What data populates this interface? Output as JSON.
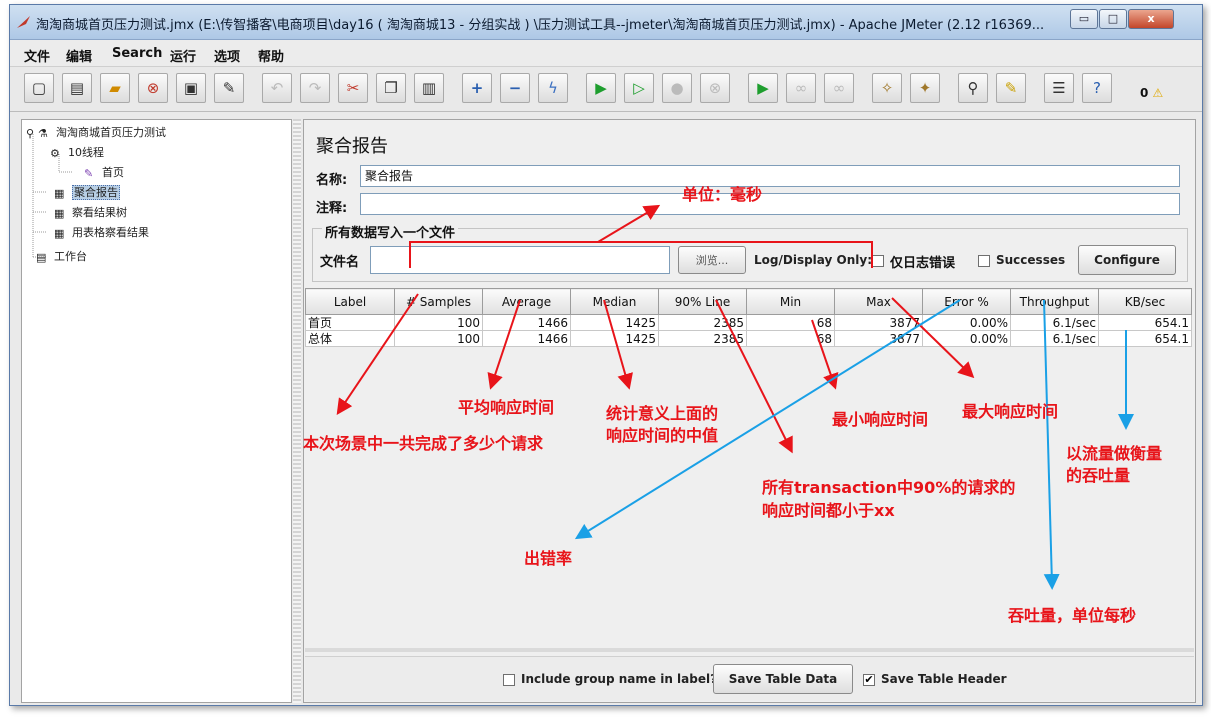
{
  "window": {
    "title": "淘淘商城首页压力测试.jmx (E:\\传智播客\\电商项目\\day16 ( 淘淘商城13 - 分组实战 ) \\压力测试工具--jmeter\\淘淘商城首页压力测试.jmx) - Apache JMeter (2.12 r16369...",
    "minimize_label": "▭",
    "maximize_label": "□",
    "close_label": "x"
  },
  "menu": [
    "文件",
    "编辑",
    "Search",
    "运行",
    "选项",
    "帮助"
  ],
  "toolbar": {
    "icons": [
      "new-icon",
      "templates-icon",
      "open-icon",
      "close-file-icon",
      "save-icon",
      "save-as-icon",
      "undo-icon",
      "redo-icon",
      "cut-icon",
      "copy-icon",
      "paste-icon",
      "expand-icon",
      "collapse-icon",
      "toggle-icon",
      "start-icon",
      "start-no-pause-icon",
      "stop-icon",
      "shutdown-icon",
      "remote-start-icon",
      "remote-stop-icon",
      "remote-exit-icon",
      "clear-icon",
      "clear-all-icon",
      "search-icon",
      "reset-search-icon",
      "function-helper-icon",
      "help-icon"
    ],
    "warn_count": "0"
  },
  "tree": [
    {
      "label": "淘淘商城首页压力测试",
      "icon": "test-plan-icon"
    },
    {
      "label": "10线程",
      "icon": "thread-group-icon"
    },
    {
      "label": "首页",
      "icon": "http-sampler-icon"
    },
    {
      "label": "聚合报告",
      "icon": "listener-icon"
    },
    {
      "label": "察看结果树",
      "icon": "listener-icon"
    },
    {
      "label": "用表格察看结果",
      "icon": "listener-icon"
    },
    {
      "label": "工作台",
      "icon": "workbench-icon"
    }
  ],
  "panel": {
    "title": "聚合报告",
    "name_label": "名称:",
    "name_value": "聚合报告",
    "comment_label": "注释:",
    "comment_value": "",
    "group_title": "所有数据写入一个文件",
    "filename_label": "文件名",
    "filename_value": "",
    "browse_label": "浏览...",
    "log_display_label": "Log/Display Only:",
    "errors_only_label": "仅日志错误",
    "successes_label": "Successes",
    "configure_label": "Configure"
  },
  "table": {
    "headers": [
      "Label",
      "# Samples",
      "Average",
      "Median",
      "90% Line",
      "Min",
      "Max",
      "Error %",
      "Throughput",
      "KB/sec"
    ],
    "rows": [
      [
        "首页",
        "100",
        "1466",
        "1425",
        "2385",
        "68",
        "3877",
        "0.00%",
        "6.1/sec",
        "654.1"
      ],
      [
        "总体",
        "100",
        "1466",
        "1425",
        "2385",
        "68",
        "3877",
        "0.00%",
        "6.1/sec",
        "654.1"
      ]
    ]
  },
  "bottom": {
    "include_group_label": "Include group name in label?",
    "save_table_data_label": "Save Table Data",
    "save_table_header_label": "Save Table Header",
    "save_header_checked": "✔"
  },
  "annotations": {
    "unit_ms": "单位：毫秒",
    "samples": "本次场景中一共完成了多少个请求",
    "average": "平均响应时间",
    "median_1": "统计意义上面的",
    "median_2": "响应时间的中值",
    "min": "最小响应时间",
    "max": "最大响应时间",
    "line90_1": "所有transaction中90%的请求的",
    "line90_2": "响应时间都小于xx",
    "error": "出错率",
    "throughput": "吞吐量，单位每秒",
    "kb_1": "以流量做衡量",
    "kb_2": "的吞吐量"
  },
  "colors": {
    "annotation_red": "#e8141a",
    "annotation_blue": "#1aa0e6"
  }
}
